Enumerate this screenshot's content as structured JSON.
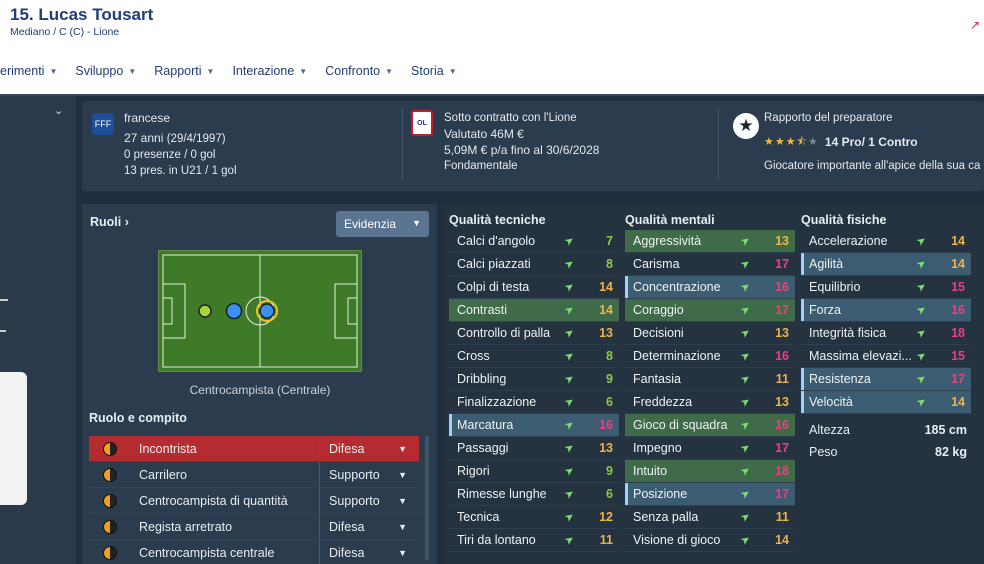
{
  "header": {
    "name": "15. Lucas Tousart",
    "role": "Mediano / C (C) - Lione"
  },
  "nav": [
    {
      "label": "erimenti"
    },
    {
      "label": "Sviluppo"
    },
    {
      "label": "Rapporti"
    },
    {
      "label": "Interazione"
    },
    {
      "label": "Confronto"
    },
    {
      "label": "Storia"
    }
  ],
  "info": {
    "nationality": "francese",
    "age": "27 anni",
    "dob": "(29/4/1997)",
    "apps": "0 presenze / 0 gol",
    "u21": "13 pres. in U21 / 1 gol",
    "contract": "Sotto contratto con l'Lione",
    "value": "Valutato 46M €",
    "wage": "5,09M € p/a fino al 30/6/2028",
    "status": "Fondamentale",
    "coach_report": "Rapporto del preparatore",
    "pros_cons": "14 Pro/ 1 Contro",
    "stars_value": 3.5,
    "coach_desc": "Giocatore importante all'apice della sua ca",
    "club_icon": "lyon-crest-icon",
    "nat_icon": "france-federation-icon"
  },
  "roles": {
    "title": "Ruoli ›",
    "evid_label": "Evidenzia",
    "pitch_caption": "Centrocampista (Centrale)",
    "task_title": "Ruolo e compito",
    "rows": [
      {
        "name": "Incontrista",
        "duty": "Difesa"
      },
      {
        "name": "Carrilero",
        "duty": "Supporto"
      },
      {
        "name": "Centrocampista di quantità",
        "duty": "Supporto"
      },
      {
        "name": "Regista arretrato",
        "duty": "Difesa"
      },
      {
        "name": "Centrocampista centrale",
        "duty": "Difesa"
      }
    ]
  },
  "attributes": {
    "technical": {
      "title": "Qualità tecniche",
      "items": [
        {
          "name": "Calci d'angolo",
          "value": "7"
        },
        {
          "name": "Calci piazzati",
          "value": "8"
        },
        {
          "name": "Colpi di testa",
          "value": "14"
        },
        {
          "name": "Contrasti",
          "value": "14"
        },
        {
          "name": "Controllo di palla",
          "value": "13"
        },
        {
          "name": "Cross",
          "value": "8"
        },
        {
          "name": "Dribbling",
          "value": "9"
        },
        {
          "name": "Finalizzazione",
          "value": "6"
        },
        {
          "name": "Marcatura",
          "value": "16"
        },
        {
          "name": "Passaggi",
          "value": "13"
        },
        {
          "name": "Rigori",
          "value": "9"
        },
        {
          "name": "Rimesse lunghe",
          "value": "6"
        },
        {
          "name": "Tecnica",
          "value": "12"
        },
        {
          "name": "Tiri da lontano",
          "value": "11"
        }
      ]
    },
    "mental": {
      "title": "Qualità mentali",
      "items": [
        {
          "name": "Aggressività",
          "value": "13"
        },
        {
          "name": "Carisma",
          "value": "17"
        },
        {
          "name": "Concentrazione",
          "value": "16"
        },
        {
          "name": "Coraggio",
          "value": "17"
        },
        {
          "name": "Decisioni",
          "value": "13"
        },
        {
          "name": "Determinazione",
          "value": "16"
        },
        {
          "name": "Fantasia",
          "value": "11"
        },
        {
          "name": "Freddezza",
          "value": "13"
        },
        {
          "name": "Gioco di squadra",
          "value": "16"
        },
        {
          "name": "Impegno",
          "value": "17"
        },
        {
          "name": "Intuito",
          "value": "18"
        },
        {
          "name": "Posizione",
          "value": "17"
        },
        {
          "name": "Senza palla",
          "value": "11"
        },
        {
          "name": "Visione di gioco",
          "value": "14"
        }
      ]
    },
    "physical": {
      "title": "Qualità fisiche",
      "items": [
        {
          "name": "Accelerazione",
          "value": "14"
        },
        {
          "name": "Agilità",
          "value": "14"
        },
        {
          "name": "Equilibrio",
          "value": "15"
        },
        {
          "name": "Forza",
          "value": "16"
        },
        {
          "name": "Integrità fisica",
          "value": "18"
        },
        {
          "name": "Massima elevazi...",
          "value": "15"
        },
        {
          "name": "Resistenza",
          "value": "17"
        },
        {
          "name": "Velocità",
          "value": "14"
        }
      ],
      "height_label": "Altezza",
      "height": "185 cm",
      "weight_label": "Peso",
      "weight": "82 kg"
    }
  }
}
